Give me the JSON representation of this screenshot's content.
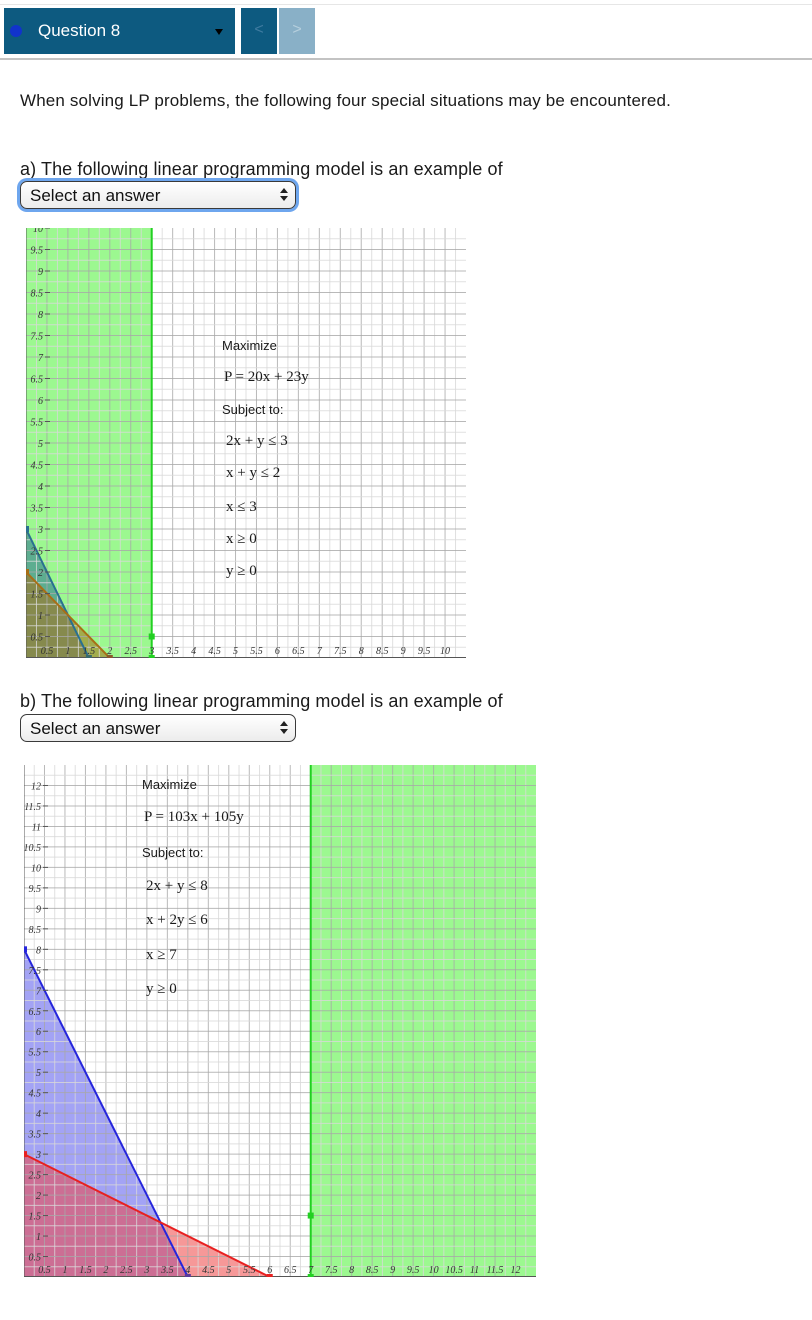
{
  "header": {
    "question_label": "Question 8",
    "prev_glyph": "<",
    "next_glyph": ">"
  },
  "intro_text": "When solving LP problems, the following four special situations may be encountered.",
  "parts": [
    {
      "prompt": "a)  The following linear programming model is an example of",
      "select_value": "Select an answer",
      "model": [
        "Maximize",
        "P = 20x + 23y",
        "Subject to:",
        "2x + y ≤ 3",
        "x + y ≤ 2",
        "x ≤ 3",
        "x ≥ 0",
        "y ≥ 0"
      ]
    },
    {
      "prompt": "b)  The following linear programming model is an example of",
      "select_value": "Select an answer",
      "model": [
        "Maximize",
        "P = 103x + 105y",
        "Subject to:",
        "2x + y ≤  8",
        "x + 2y ≤  6",
        "x ≥  7",
        "y ≥ 0"
      ]
    }
  ],
  "colors": {
    "header_bg": "#0d5a80",
    "nav_disabled_bg": "#89b0c7",
    "focus_ring": "#6ea6ee",
    "green_region": "#9cf890",
    "green_line": "#22d022",
    "blue_region": "#9c9cf8",
    "blue_line": "#2626dc",
    "red_region": "#f28b8b",
    "red_line": "#e82020",
    "teal_line": "#2a7090",
    "olive_line": "#a86e16"
  },
  "chart_data": [
    {
      "type": "area",
      "xlim": [
        0,
        10.5
      ],
      "ylim": [
        0,
        10
      ],
      "x_ticks": [
        "0.5",
        "1",
        "1.5",
        "2",
        "2.5",
        "3",
        "3.5",
        "4",
        "4.5",
        "5",
        "5.5",
        "6",
        "6.5",
        "7",
        "7.5",
        "8",
        "8.5",
        "9",
        "9.5",
        "10"
      ],
      "y_ticks": [
        "0.5",
        "1",
        "1.5",
        "2",
        "2.5",
        "3",
        "3.5",
        "4",
        "4.5",
        "5",
        "5.5",
        "6",
        "6.5",
        "7",
        "7.5",
        "8",
        "8.5",
        "9",
        "9.5",
        "10"
      ],
      "grid": true,
      "series": [
        {
          "label": "2x + y ≤ 3",
          "line": [
            [
              0,
              3
            ],
            [
              1.5,
              0
            ]
          ]
        },
        {
          "label": "x + y ≤ 2",
          "line": [
            [
              0,
              2
            ],
            [
              2,
              0
            ]
          ]
        },
        {
          "label": "x ≤ 3",
          "line": [
            [
              3,
              0
            ],
            [
              3,
              10
            ]
          ]
        }
      ]
    },
    {
      "type": "area",
      "xlim": [
        0,
        12.5
      ],
      "ylim": [
        0,
        12.5
      ],
      "x_ticks": [
        "0.5",
        "1",
        "1.5",
        "2",
        "2.5",
        "3",
        "3.5",
        "4",
        "4.5",
        "5",
        "5.5",
        "6",
        "6.5",
        "7",
        "7.5",
        "8",
        "8.5",
        "9",
        "9.5",
        "10",
        "10.5",
        "11",
        "11.5",
        "12"
      ],
      "y_ticks": [
        "0.5",
        "1",
        "1.5",
        "2",
        "2.5",
        "3",
        "3.5",
        "4",
        "4.5",
        "5",
        "5.5",
        "6",
        "6.5",
        "7",
        "7.5",
        "8",
        "8.5",
        "9",
        "9.5",
        "10",
        "10.5",
        "11",
        "11.5",
        "12"
      ],
      "grid": true,
      "series": [
        {
          "label": "2x + y ≤ 8",
          "line": [
            [
              0,
              8
            ],
            [
              4,
              0
            ]
          ]
        },
        {
          "label": "x + 2y ≤ 6",
          "line": [
            [
              0,
              3
            ],
            [
              6,
              0
            ]
          ]
        },
        {
          "label": "x ≥ 7",
          "line": [
            [
              7,
              0
            ],
            [
              7,
              12.5
            ]
          ]
        }
      ]
    }
  ]
}
